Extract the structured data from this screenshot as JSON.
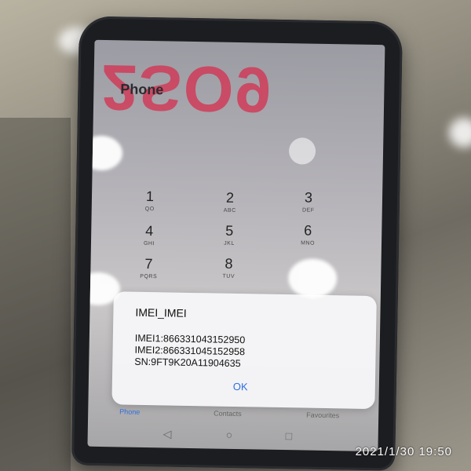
{
  "app": {
    "title": "Phone"
  },
  "reflection_text": "2SO9",
  "dialpad": [
    {
      "digit": "1",
      "letters": "QO"
    },
    {
      "digit": "2",
      "letters": "ABC"
    },
    {
      "digit": "3",
      "letters": "DEF"
    },
    {
      "digit": "4",
      "letters": "GHI"
    },
    {
      "digit": "5",
      "letters": "JKL"
    },
    {
      "digit": "6",
      "letters": "MNO"
    },
    {
      "digit": "7",
      "letters": "PQRS"
    },
    {
      "digit": "8",
      "letters": "TUV"
    }
  ],
  "dialog": {
    "title": "IMEI_IMEI",
    "imei1": "IMEI1:866331043152950",
    "imei2": "IMEI2:866331045152958",
    "sn": "SN:9FT9K20A11904635",
    "ok_label": "OK"
  },
  "tabs": {
    "phone": "Phone",
    "contacts": "Contacts",
    "favourites": "Favourites"
  },
  "navbar": {
    "back": "◁",
    "home": "○",
    "recents": "□"
  },
  "timestamp": "2021/1/30  19:50",
  "colors": {
    "accent": "#2f6fe0",
    "reflection": "#d62e4e"
  }
}
